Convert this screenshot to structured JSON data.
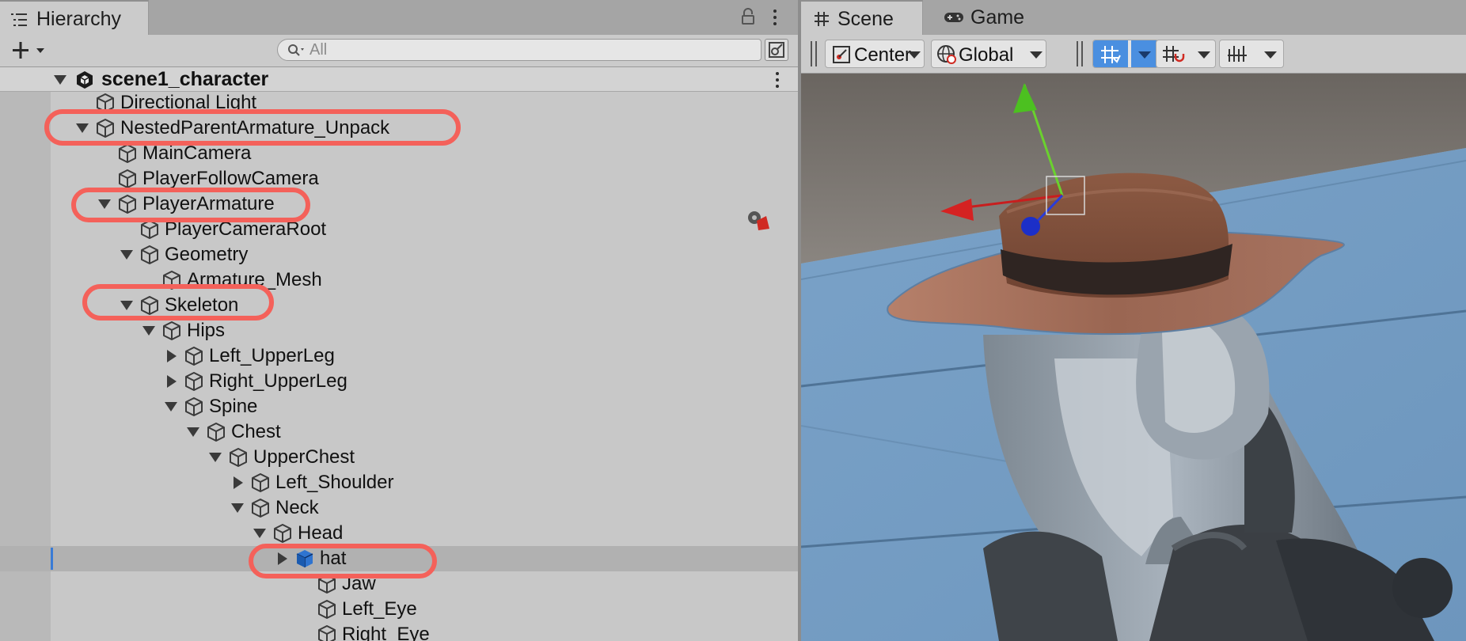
{
  "hierarchy": {
    "tab_label": "Hierarchy",
    "search_placeholder": "All",
    "scene_name": "scene1_character",
    "rows": [
      {
        "label": "Directional Light"
      },
      {
        "label": "NestedParentArmature_Unpack"
      },
      {
        "label": "MainCamera"
      },
      {
        "label": "PlayerFollowCamera"
      },
      {
        "label": "PlayerArmature"
      },
      {
        "label": "PlayerCameraRoot"
      },
      {
        "label": "Geometry"
      },
      {
        "label": "Armature_Mesh"
      },
      {
        "label": "Skeleton"
      },
      {
        "label": "Hips"
      },
      {
        "label": "Left_UpperLeg"
      },
      {
        "label": "Right_UpperLeg"
      },
      {
        "label": "Spine"
      },
      {
        "label": "Chest"
      },
      {
        "label": "UpperChest"
      },
      {
        "label": "Left_Shoulder"
      },
      {
        "label": "Neck"
      },
      {
        "label": "Head"
      },
      {
        "label": "hat"
      },
      {
        "label": "Jaw"
      },
      {
        "label": "Left_Eye"
      },
      {
        "label": "Right_Eye"
      }
    ]
  },
  "scene_view": {
    "tabs": [
      {
        "label": "Scene"
      },
      {
        "label": "Game"
      }
    ],
    "pivot_mode": "Center",
    "pivot_rotation": "Global"
  },
  "colors": {
    "highlight_oval": "#f4615a",
    "selection_bar": "#3a7bd5",
    "prefab_blue": "#2f74d0"
  }
}
